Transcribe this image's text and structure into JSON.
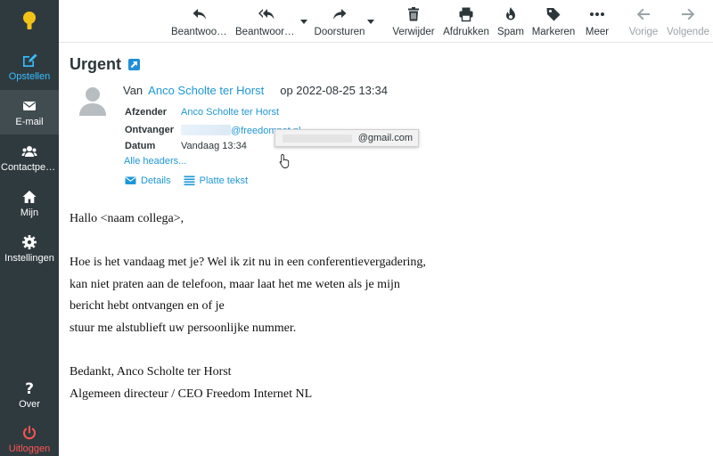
{
  "sidebar": {
    "items": [
      {
        "label": "Opstellen",
        "icon": "compose-icon"
      },
      {
        "label": "E-mail",
        "icon": "envelope-icon"
      },
      {
        "label": "Contactpersonen",
        "icon": "contacts-icon"
      },
      {
        "label": "Mijn",
        "icon": "home-icon"
      },
      {
        "label": "Instellingen",
        "icon": "gear-icon"
      },
      {
        "label": "Over",
        "icon": "question-icon"
      },
      {
        "label": "Uitloggen",
        "icon": "power-icon"
      }
    ],
    "colors": {
      "background": "#2f3a3f",
      "accent": "#37beff",
      "logout": "#ff5552",
      "logo": "#f3c218"
    }
  },
  "toolbar": {
    "reply": "Beantwoorden",
    "reply_all": "Beantwoorden aan allen",
    "forward": "Doorsturen",
    "delete": "Verwijder",
    "print": "Afdrukken",
    "spam": "Spam",
    "mark": "Markeren",
    "more": "Meer",
    "previous": "Vorige",
    "next": "Volgende"
  },
  "message": {
    "subject": "Urgent",
    "from_prefix": "Van",
    "from_name": "Anco Scholte ter Horst",
    "date_suffix": "op 2022-08-25 13:34",
    "headers": {
      "sender_label": "Afzender",
      "sender_value": "Anco Scholte ter Horst",
      "recipient_label": "Ontvanger",
      "recipient_value": "@freedomnet.nl",
      "date_label": "Datum",
      "date_value": "Vandaag 13:34"
    },
    "tooltip_email": "@gmail.com",
    "all_headers": "Alle headers...",
    "details": "Details",
    "plain_text": "Platte tekst",
    "body_lines": [
      "Hallo <naam collega>,",
      "",
      "Hoe is het vandaag met je? Wel ik zit nu in een conferentievergadering,",
      "kan niet praten aan de telefoon, maar laat het me weten als je mijn",
      "bericht hebt ontvangen en of je",
      "stuur me alstublieft uw persoonlijke nummer.",
      "",
      "Bedankt, Anco Scholte ter Horst",
      "Algemeen directeur / CEO Freedom Internet NL"
    ]
  }
}
